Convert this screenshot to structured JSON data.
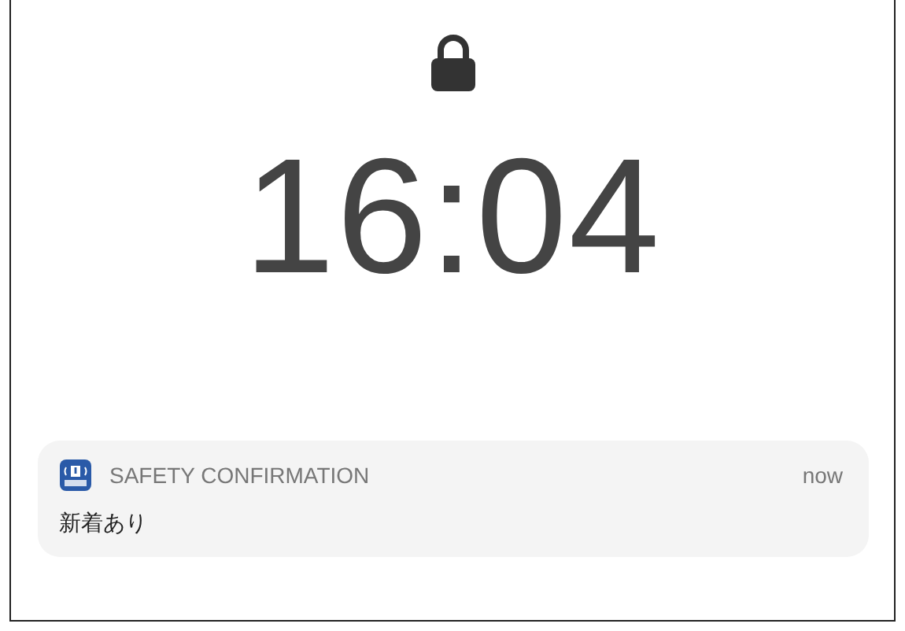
{
  "lock_screen": {
    "time": "16:04"
  },
  "notification": {
    "app_name": "SAFETY CONFIRMATION",
    "timestamp": "now",
    "message": "新着あり"
  }
}
